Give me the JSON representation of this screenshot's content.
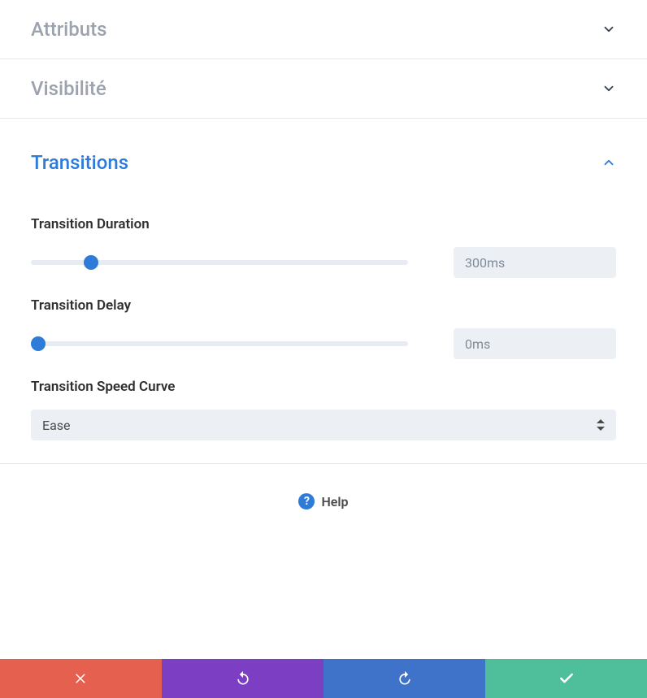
{
  "sections": {
    "attributs": {
      "title": "Attributs",
      "expanded": false
    },
    "visibilite": {
      "title": "Visibilité",
      "expanded": false
    },
    "transitions": {
      "title": "Transitions",
      "expanded": true,
      "duration": {
        "label": "Transition Duration",
        "value": "300ms",
        "slider_percent": 16
      },
      "delay": {
        "label": "Transition Delay",
        "value": "0ms",
        "slider_percent": 2
      },
      "speed_curve": {
        "label": "Transition Speed Curve",
        "selected": "Ease"
      }
    }
  },
  "help": {
    "label": "Help"
  },
  "footer": {
    "cancel": {
      "name": "cancel",
      "color": "#e6604f"
    },
    "undo": {
      "name": "undo",
      "color": "#7c3fc4"
    },
    "redo": {
      "name": "redo",
      "color": "#3f72c9"
    },
    "save": {
      "name": "save",
      "color": "#4fbf9b"
    }
  }
}
